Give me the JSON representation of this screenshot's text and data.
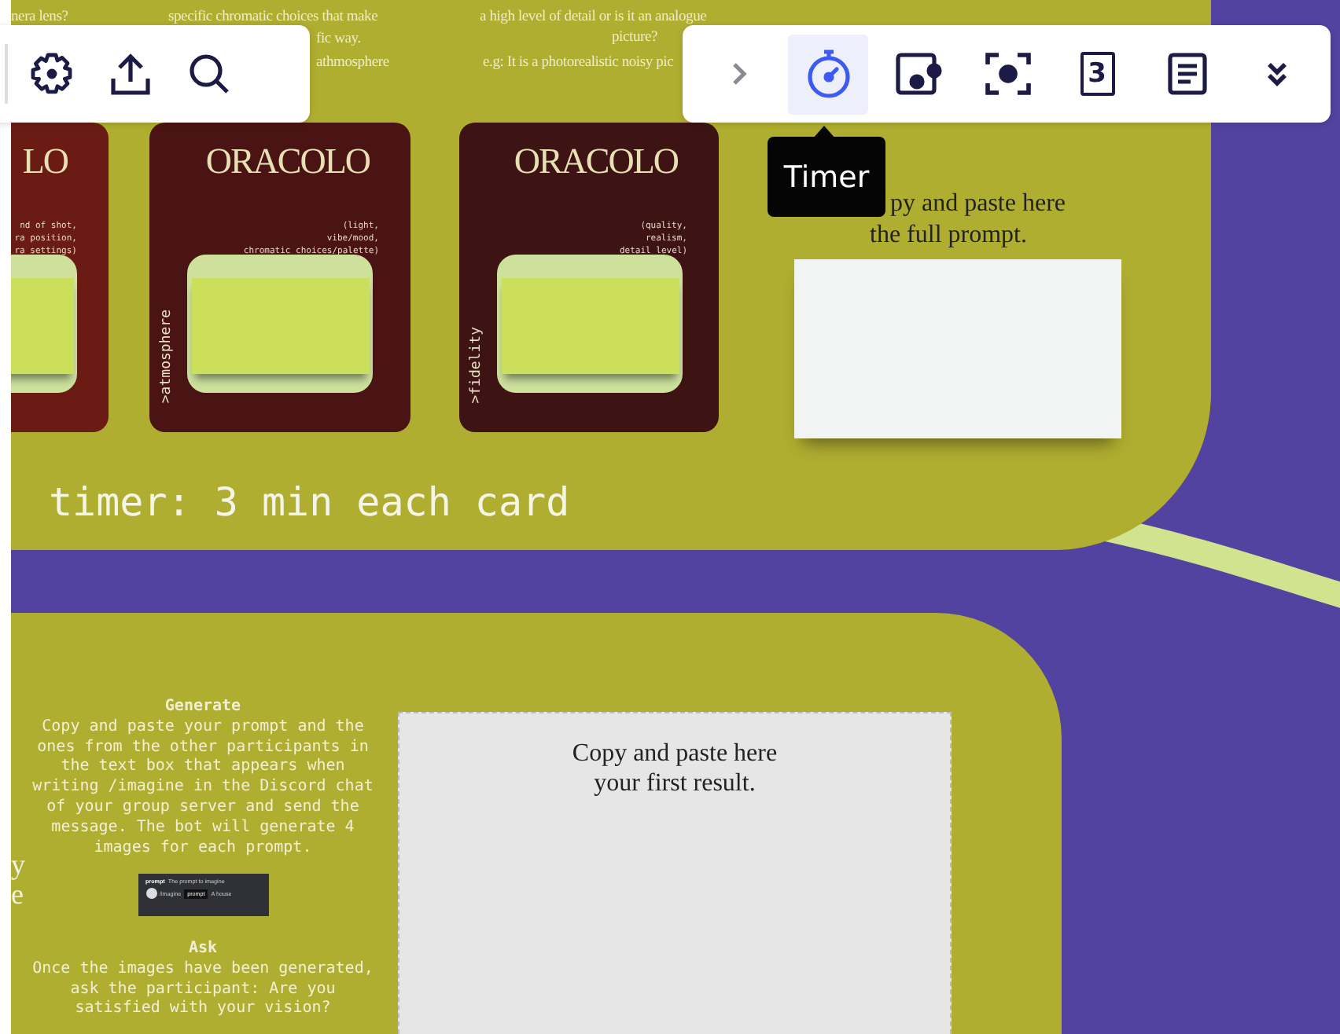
{
  "canvas_snippets": [
    "nera lens?",
    "specific chromatic choices that make",
    "fic way.",
    "athmosphere",
    "a high level of detail or is it an analogue",
    "picture?",
    "e.g: It is a photorealistic noisy pic"
  ],
  "left_toolbar": {
    "tools": [
      {
        "kind": "settings",
        "selected": false
      },
      {
        "kind": "upload",
        "selected": false
      },
      {
        "kind": "search",
        "selected": false
      }
    ]
  },
  "right_toolbar": {
    "tools": [
      {
        "kind": "collapse",
        "selected": false
      },
      {
        "kind": "timer",
        "selected": true
      },
      {
        "kind": "media",
        "selected": false
      },
      {
        "kind": "focus",
        "selected": false
      },
      {
        "kind": "number-card",
        "text": "3",
        "selected": false
      },
      {
        "kind": "notes",
        "selected": false
      },
      {
        "kind": "more",
        "selected": false
      }
    ]
  },
  "tooltip": "Timer",
  "cards": [
    {
      "logo": "LO",
      "spec": [
        "nd of shot,",
        "ra position,",
        "ra settings)"
      ],
      "color": "#6a1c14"
    },
    {
      "logo": "ORACOLO",
      "spec": [
        "(light,",
        "vibe/mood,",
        "chromatic choices/palette)"
      ],
      "side_label": ">atmosphere",
      "color": "#4a1414"
    },
    {
      "logo": "ORACOLO",
      "spec": [
        "(quality,",
        "realism,",
        "detail level)"
      ],
      "side_label": ">fidelity",
      "color": "#3e1313"
    }
  ],
  "timer_note": "timer: 3 min each card",
  "prompt_box": {
    "label_lines": [
      "py and paste here",
      "the full prompt."
    ]
  },
  "edge_letters": [
    "y",
    "e"
  ],
  "generate": {
    "title": "Generate",
    "text": "Copy and paste your prompt and the ones from the other participants in the text box that appears when writing /imagine in the Discord chat of your group server and send the message. The bot will generate 4 images for each prompt.",
    "preview": {
      "hint_key": "prompt",
      "hint": "The prompt to imagine",
      "command": "/imagine",
      "option": "prompt",
      "value": "A house"
    }
  },
  "ask": {
    "title": "Ask",
    "text": "Once the images have been generated, ask the participant: Are you satisfied with your vision?"
  },
  "result_box": {
    "label": "Copy and paste here your first result."
  }
}
